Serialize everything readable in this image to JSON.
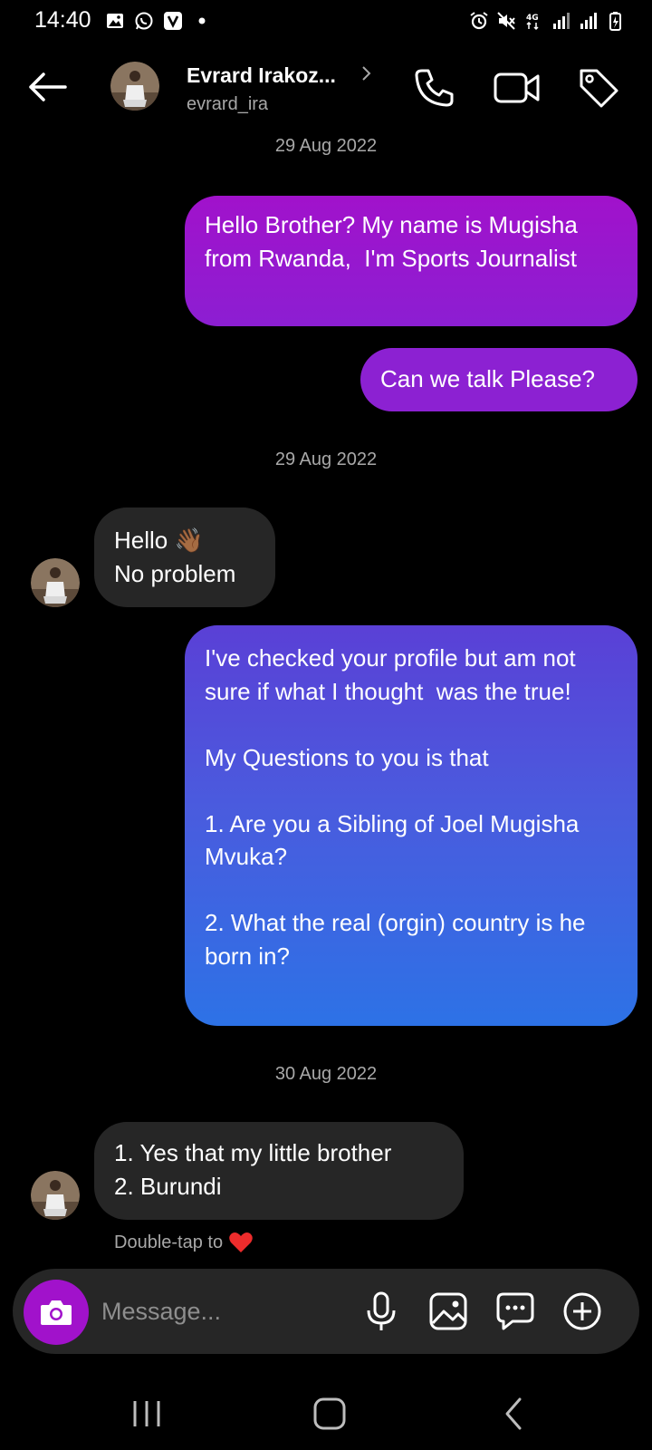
{
  "status_bar": {
    "time": "14:40",
    "left_icons": [
      "gallery-icon",
      "whatsapp-icon",
      "v-app-icon",
      "dot-icon"
    ],
    "right_icons": [
      "alarm-icon",
      "mute-icon",
      "network-4g-icon",
      "signal-icon",
      "signal-icon",
      "battery-charging-icon"
    ],
    "network_label": "4G"
  },
  "header": {
    "name": "Evrard Irakoz...",
    "username": "evrard_ira",
    "icons": [
      "back-arrow-icon",
      "chevron-right-icon",
      "phone-icon",
      "video-camera-icon",
      "tag-icon"
    ]
  },
  "messages": [
    {
      "type": "date",
      "text": "29 Aug 2022"
    },
    {
      "type": "outgoing",
      "text": "Hello Brother? My name is Mugisha from Rwanda,  I'm Sports Journalist"
    },
    {
      "type": "outgoing",
      "text": "Can we talk Please?"
    },
    {
      "type": "date",
      "text": "29 Aug 2022"
    },
    {
      "type": "incoming",
      "text": "Hello 👋🏾\nNo problem"
    },
    {
      "type": "outgoing",
      "text": "I've checked your profile but am not sure if what I thought  was the true!\n\nMy Questions to you is that\n\n1. Are you a Sibling of Joel Mugisha Mvuka?\n\n2. What the real (orgin) country is he born in?"
    },
    {
      "type": "date",
      "text": "30 Aug 2022"
    },
    {
      "type": "incoming",
      "text": "1. Yes that my little brother\n2. Burundi"
    }
  ],
  "double_tap_hint": "Double-tap to",
  "double_tap_icon": "heart-icon",
  "composer": {
    "placeholder": "Message...",
    "icons": [
      "camera-icon",
      "microphone-icon",
      "gallery-icon",
      "sticker-chat-icon",
      "plus-circle-icon"
    ]
  },
  "nav_bar": {
    "icons": [
      "recent-apps-icon",
      "home-icon",
      "back-icon"
    ]
  },
  "colors": {
    "background": "#000000",
    "incoming_bubble": "#262626",
    "outgoing_top": "#a112cb",
    "outgoing_bottom": "#2d72e6",
    "accent": "#a112cb",
    "heart": "#ed2c2c"
  }
}
